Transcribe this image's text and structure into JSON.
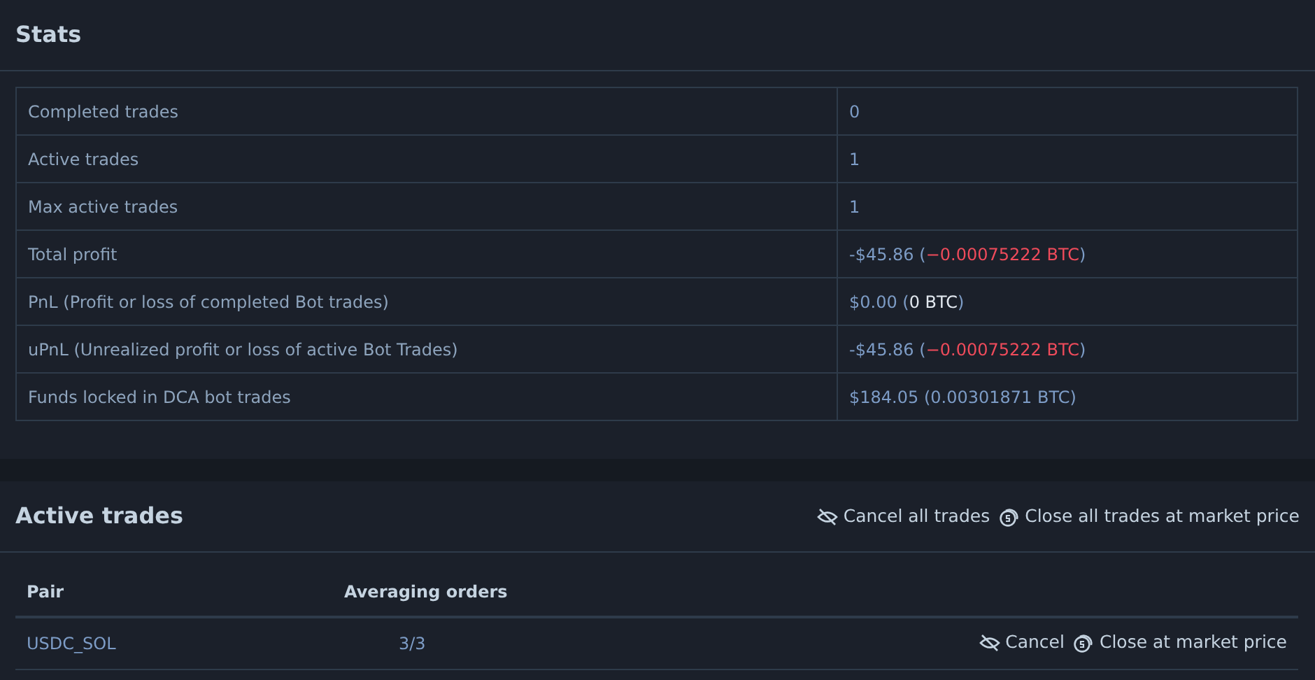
{
  "stats": {
    "title": "Stats",
    "rows": [
      {
        "label": "Completed trades",
        "value": [
          {
            "text": "0"
          }
        ]
      },
      {
        "label": "Active trades",
        "value": [
          {
            "text": "1"
          }
        ]
      },
      {
        "label": "Max active trades",
        "value": [
          {
            "text": "1"
          }
        ]
      },
      {
        "label": "Total profit",
        "value": [
          {
            "text": "-$45.86 ("
          },
          {
            "text": "−0.00075222 BTC",
            "color": "#ef4b5b"
          },
          {
            "text": ")"
          }
        ]
      },
      {
        "label": "PnL (Profit or loss of completed Bot trades)",
        "value": [
          {
            "text": "$0.00 ("
          },
          {
            "text": "0 BTC",
            "color": "#e2e8ef"
          },
          {
            "text": ")"
          }
        ]
      },
      {
        "label": "uPnL (Unrealized profit or loss of active Bot Trades)",
        "value": [
          {
            "text": "-$45.86 ("
          },
          {
            "text": "−0.00075222 BTC",
            "color": "#ef4b5b"
          },
          {
            "text": ")"
          }
        ]
      },
      {
        "label": "Funds locked in DCA bot trades",
        "value": [
          {
            "text": "$184.05 (0.00301871 BTC)"
          }
        ]
      }
    ]
  },
  "active_trades": {
    "title": "Active trades",
    "actions": [
      {
        "label": "Cancel all trades",
        "kind": "cancel"
      },
      {
        "label": "Close all trades at market price",
        "kind": "close"
      }
    ],
    "columns": [
      "Pair",
      "Averaging orders"
    ],
    "rows": [
      {
        "pair": "USDC_SOL",
        "averaging_orders": "3/3",
        "actions": [
          {
            "label": "Cancel",
            "kind": "cancel"
          },
          {
            "label": "Close at market price",
            "kind": "close"
          }
        ]
      }
    ]
  }
}
